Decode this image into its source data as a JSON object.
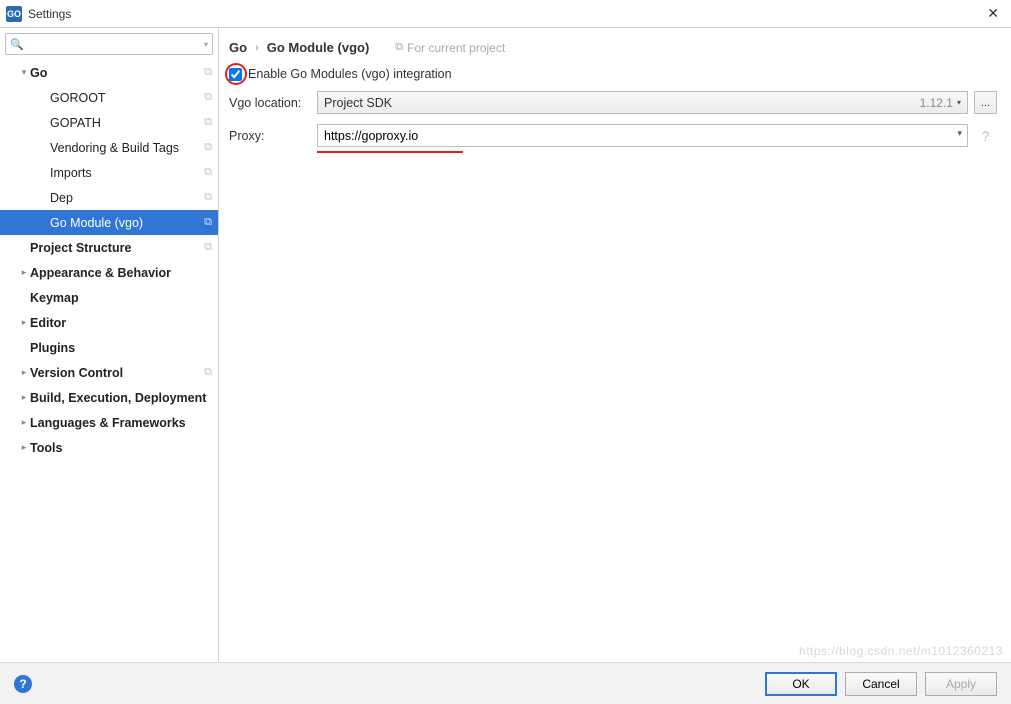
{
  "window": {
    "title": "Settings",
    "app_badge": "GO"
  },
  "search": {
    "placeholder": ""
  },
  "sidebar": {
    "items": [
      {
        "label": "Go",
        "indent": 0,
        "bold": true,
        "arrow": "down",
        "copy": true
      },
      {
        "label": "GOROOT",
        "indent": 1,
        "bold": false,
        "copy": true
      },
      {
        "label": "GOPATH",
        "indent": 1,
        "bold": false,
        "copy": true
      },
      {
        "label": "Vendoring & Build Tags",
        "indent": 1,
        "bold": false,
        "copy": true
      },
      {
        "label": "Imports",
        "indent": 1,
        "bold": false,
        "copy": true
      },
      {
        "label": "Dep",
        "indent": 1,
        "bold": false,
        "copy": true
      },
      {
        "label": "Go Module (vgo)",
        "indent": 1,
        "bold": false,
        "copy": true,
        "selected": true
      },
      {
        "label": "Project Structure",
        "indent": 0,
        "bold": true,
        "copy": true
      },
      {
        "label": "Appearance & Behavior",
        "indent": 0,
        "bold": true,
        "arrow": "right"
      },
      {
        "label": "Keymap",
        "indent": 0,
        "bold": true
      },
      {
        "label": "Editor",
        "indent": 0,
        "bold": true,
        "arrow": "right"
      },
      {
        "label": "Plugins",
        "indent": 0,
        "bold": true
      },
      {
        "label": "Version Control",
        "indent": 0,
        "bold": true,
        "arrow": "right",
        "copy": true
      },
      {
        "label": "Build, Execution, Deployment",
        "indent": 0,
        "bold": true,
        "arrow": "right"
      },
      {
        "label": "Languages & Frameworks",
        "indent": 0,
        "bold": true,
        "arrow": "right"
      },
      {
        "label": "Tools",
        "indent": 0,
        "bold": true,
        "arrow": "right"
      }
    ]
  },
  "breadcrumb": {
    "root": "Go",
    "leaf": "Go Module (vgo)",
    "for_project": "For current project"
  },
  "form": {
    "enable_label": "Enable Go Modules (vgo) integration",
    "enable_checked": true,
    "vgo_location_label": "Vgo location:",
    "vgo_location_value": "Project SDK",
    "vgo_version": "1.12.1",
    "browse_label": "...",
    "proxy_label": "Proxy:",
    "proxy_value": "https://goproxy.io"
  },
  "footer": {
    "ok": "OK",
    "cancel": "Cancel",
    "apply": "Apply"
  },
  "watermark": "https://blog.csdn.net/m1012360213"
}
